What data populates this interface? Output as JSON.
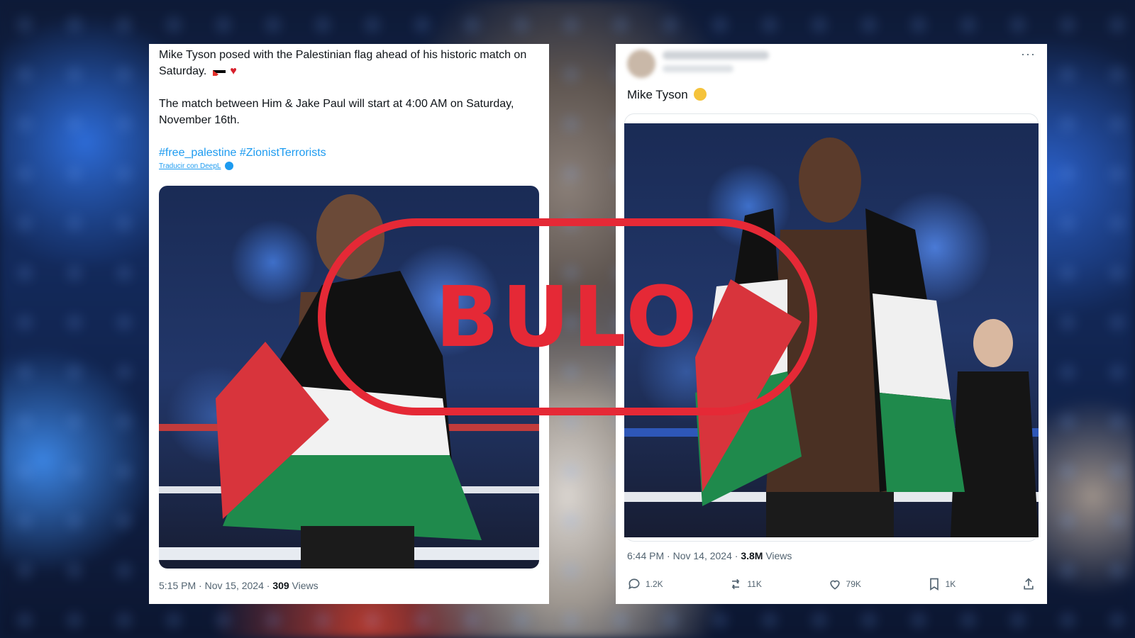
{
  "left_tweet": {
    "text_line1": "Mike Tyson posed with the Palestinian flag ahead of his historic match on Saturday.",
    "text_line2": "The match between Him & Jake Paul will start at 4:00 AM on Saturday, November 16th.",
    "hashtags": "#free_palestine #ZionistTerrorists",
    "translate_label": "Traducir con DeepL",
    "time": "5:15 PM · Nov 15, 2024 · ",
    "views_count": "309",
    "views_label": " Views"
  },
  "right_tweet": {
    "text": "Mike Tyson",
    "more_label": "···",
    "time": "6:44 PM · Nov 14, 2024 · ",
    "views_count": "3.8M",
    "views_label": " Views",
    "replies": "1.2K",
    "reposts": "11K",
    "likes": "79K",
    "bookmarks": "1K"
  },
  "stamp": {
    "label": "BULO",
    "color": "#e52936"
  },
  "icons": [
    "flag-emoji",
    "heart-emoji",
    "fist-emoji",
    "reply-icon",
    "repost-icon",
    "like-icon",
    "bookmark-icon",
    "share-icon",
    "verified-icon",
    "more-icon"
  ]
}
